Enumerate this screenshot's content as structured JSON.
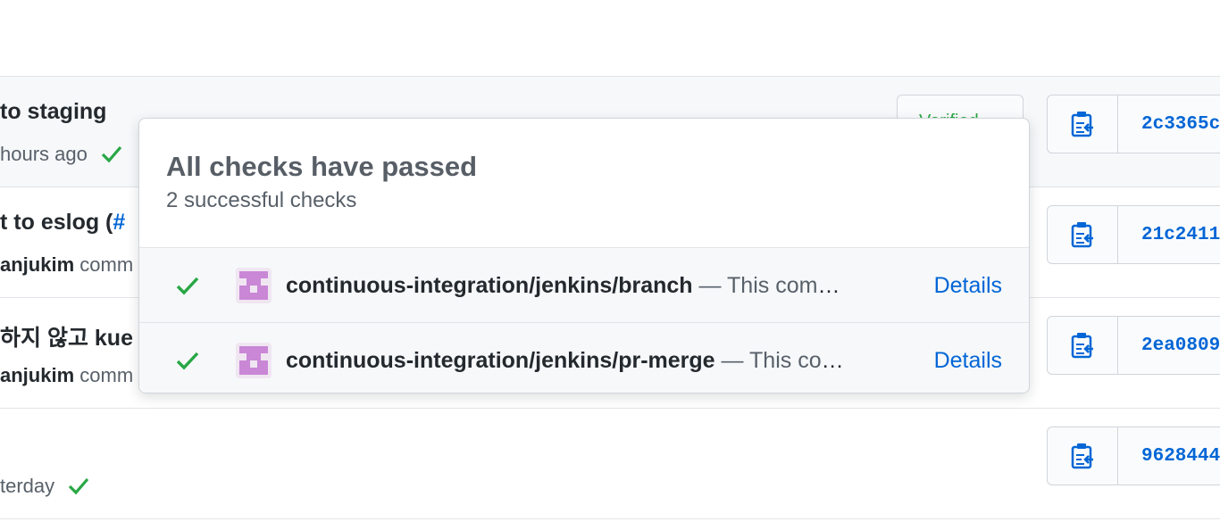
{
  "commits": [
    {
      "title": "to staging",
      "meta_time": "hours ago",
      "verified": "Verified",
      "sha": "2c3365c"
    },
    {
      "title": "t to eslog (",
      "title_link": "#",
      "author": "anjukim",
      "meta_rest": "comm",
      "sha": "21c2411"
    },
    {
      "title": "하지 않고 kue",
      "author": "anjukim",
      "meta_rest": "comm",
      "sha": "2ea0809"
    },
    {
      "title": "",
      "meta_time": "terday",
      "sha": "9628444"
    }
  ],
  "popover": {
    "title": "All checks have passed",
    "subtitle": "2 successful checks",
    "checks": [
      {
        "context": "continuous-integration/jenkins/branch",
        "description": " — This commit looks good",
        "details": "Details"
      },
      {
        "context": "continuous-integration/jenkins/pr-merge",
        "description": " — This commit looks good",
        "details": "Details"
      }
    ]
  },
  "colors": {
    "success": "#28a745",
    "link": "#0366d6",
    "avatar": "#c987d6"
  }
}
